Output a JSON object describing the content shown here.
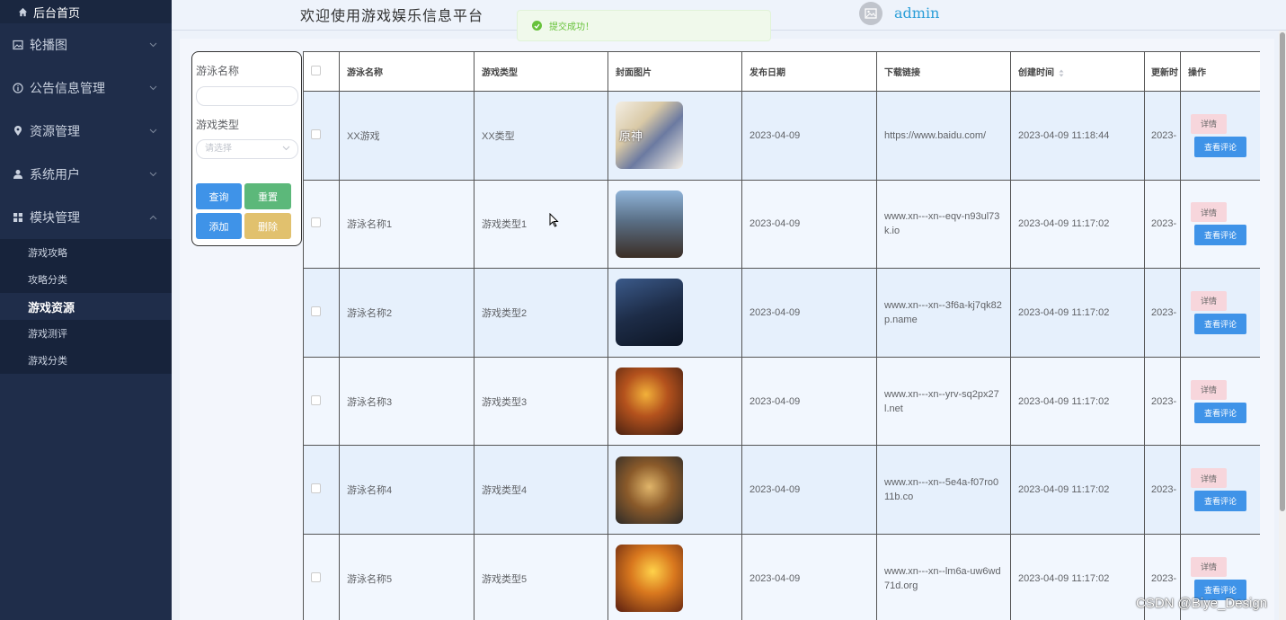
{
  "sidebar": {
    "home_label": "后台首页",
    "menu": [
      {
        "label": "轮播图"
      },
      {
        "label": "公告信息管理"
      },
      {
        "label": "资源管理"
      },
      {
        "label": "系统用户"
      },
      {
        "label": "模块管理"
      }
    ],
    "submenu": [
      {
        "label": "游戏攻略"
      },
      {
        "label": "攻略分类"
      },
      {
        "label": "游戏资源"
      },
      {
        "label": "游戏测评"
      },
      {
        "label": "游戏分类"
      }
    ]
  },
  "header": {
    "title": "欢迎使用游戏娱乐信息平台",
    "username": "admin"
  },
  "toast": {
    "message": "提交成功！"
  },
  "search": {
    "name_label": "游泳名称",
    "name_value": "",
    "type_label": "游戏类型",
    "type_placeholder": "请选择",
    "query_label": "查询",
    "reset_label": "重置",
    "add_label": "添加",
    "delete_label": "删除"
  },
  "table": {
    "headers": {
      "name": "游泳名称",
      "type": "游戏类型",
      "cover": "封面图片",
      "publish": "发布日期",
      "link": "下载链接",
      "created": "创建时间",
      "updated": "更新时",
      "ops": "操作"
    },
    "detail_label": "详情",
    "review_label": "查看评论",
    "rows": [
      {
        "name": "XX游戏",
        "type": "XX类型",
        "cover_text": "原神",
        "publish": "2023-04-09",
        "link": "https://www.baidu.com/",
        "created": "2023-04-09 11:18:44",
        "updated": "2023-"
      },
      {
        "name": "游泳名称1",
        "type": "游戏类型1",
        "publish": "2023-04-09",
        "link": "www.xn---xn--eqv-n93ul73k.io",
        "created": "2023-04-09 11:17:02",
        "updated": "2023-"
      },
      {
        "name": "游泳名称2",
        "type": "游戏类型2",
        "publish": "2023-04-09",
        "link": "www.xn---xn--3f6a-kj7qk82p.name",
        "created": "2023-04-09 11:17:02",
        "updated": "2023-"
      },
      {
        "name": "游泳名称3",
        "type": "游戏类型3",
        "publish": "2023-04-09",
        "link": "www.xn---xn--yrv-sq2px27l.net",
        "created": "2023-04-09 11:17:02",
        "updated": "2023-"
      },
      {
        "name": "游泳名称4",
        "type": "游戏类型4",
        "publish": "2023-04-09",
        "link": "www.xn---xn--5e4a-f07ro011b.co",
        "created": "2023-04-09 11:17:02",
        "updated": "2023-"
      },
      {
        "name": "游泳名称5",
        "type": "游戏类型5",
        "publish": "2023-04-09",
        "link": "www.xn---xn--lm6a-uw6wd71d.org",
        "created": "2023-04-09 11:17:02",
        "updated": "2023-"
      }
    ]
  },
  "watermark": "CSDN @Biye_Design",
  "colors": {
    "sidebar_bg": "#1f2d4a",
    "primary": "#3f93e8",
    "success": "#5cb87a",
    "warning": "#e1c16e",
    "toast_green": "#67c23a",
    "username": "#2d9fd8"
  },
  "icons": {
    "home": "home-icon",
    "carousel": "picture-icon",
    "notice": "info-circle-icon",
    "resource": "location-pin-icon",
    "users": "user-icon",
    "modules": "grid-icon"
  }
}
